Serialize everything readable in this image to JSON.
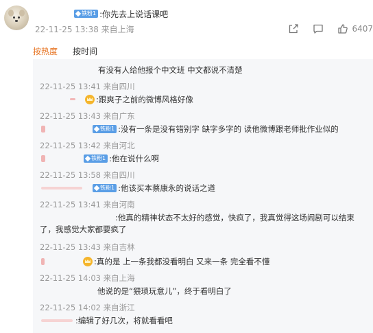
{
  "post": {
    "fan_badge": "铁粉1",
    "text": ":你先去上说话课吧",
    "meta": "22-11-25 13:38 来自上海",
    "like_count": "6407"
  },
  "tabs": [
    "按热度",
    "按时间"
  ],
  "replies": [
    {
      "text": "有没有人给他报个中文班 中文都说不清楚",
      "meta": "22-11-25 13:41 来自四川"
    },
    {
      "text": ":跟爽子之前的微博风格好像",
      "meta": "22-11-25 13:43 来自广东"
    },
    {
      "fan_badge": "铁粉1",
      "text": ":没有一条是没有错别字 缺字多字的 读他微博跟老师批作业似的",
      "meta": "22-11-25 13:42 来自河北"
    },
    {
      "fan_badge": "铁粉1",
      "text": ":他在说什么啊",
      "meta": "22-11-25 13:58 来自四川"
    },
    {
      "fan_badge": "铁粉1",
      "text": ":他该买本蔡康永的说话之道",
      "meta": "22-11-25 13:41 来自河南"
    },
    {
      "text": ":他真的精神状态不太好的感觉，快疯了，我真觉得这场闹剧可以结束",
      "text2": "了，我感觉大家都要疯了",
      "meta": "22-11-25 13:43 来自吉林"
    },
    {
      "text": ":真的是 上一条我都没看明白 又来一条  完全看不懂",
      "meta": "22-11-25 14:03 来自上海"
    },
    {
      "text": "他说的是“猥琐玩意儿”，终于看明白了",
      "meta": "22-11-25 14:02 来自浙江"
    },
    {
      "text": ":编辑了好几次，将就看看吧"
    }
  ]
}
